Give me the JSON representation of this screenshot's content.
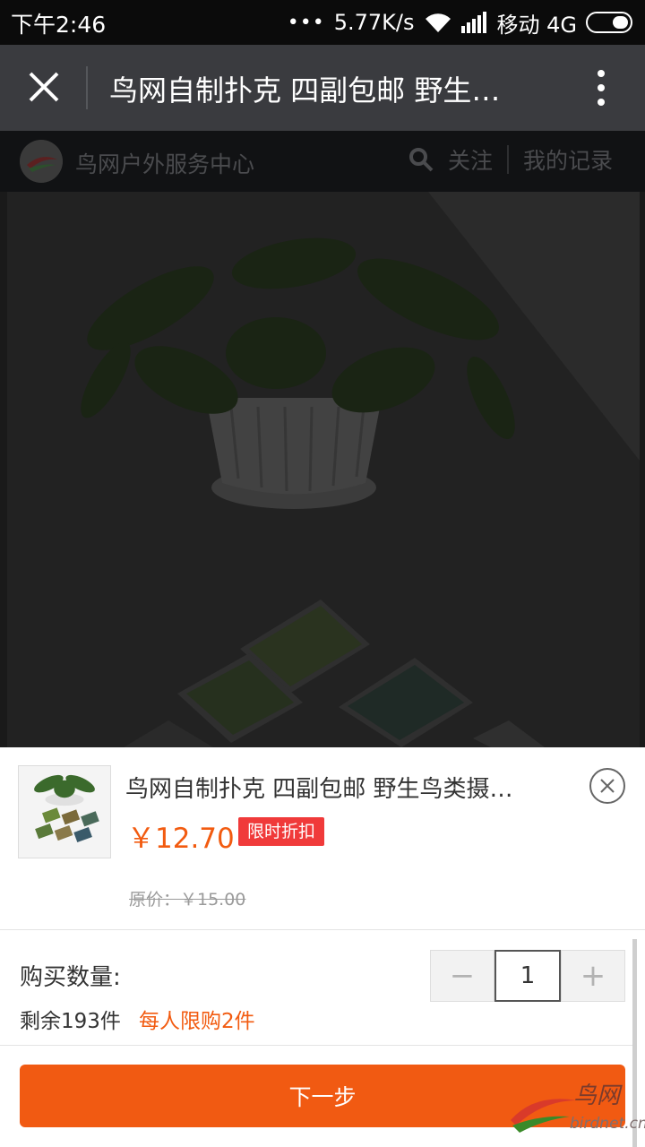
{
  "status_bar": {
    "time": "下午2:46",
    "dots": "•••",
    "net_speed": "5.77K/s",
    "carrier": "移动 4G",
    "icons": [
      "wifi-icon",
      "signal-icon",
      "battery-icon"
    ]
  },
  "title_bar": {
    "title": "鸟网自制扑克 四副包邮 野生…",
    "icons": [
      "close-icon",
      "more-vertical-icon"
    ]
  },
  "shop_header": {
    "name": "鸟网户外服务中心",
    "follow_label": "关注",
    "records_label": "我的记录",
    "icons": [
      "shop-logo-icon",
      "search-icon"
    ]
  },
  "sheet": {
    "product_title": "鸟网自制扑克 四副包邮 野生鸟类摄…",
    "price": "￥12.70",
    "discount_badge": "限时折扣",
    "original_price": "原价：￥15.00",
    "quantity_label": "购买数量:",
    "quantity_value": "1",
    "decrement_symbol": "−",
    "increment_symbol": "+",
    "stock_text": "剩余193件",
    "limit_text": "每人限购2件",
    "next_button": "下一步",
    "icons": [
      "close-circle-icon"
    ]
  },
  "watermark": {
    "text": "鸟网",
    "url": "birdnet.cn"
  },
  "colors": {
    "accent_orange": "#f15a12",
    "badge_red": "#f03a3a",
    "title_bar_bg": "#3a3b3f"
  }
}
